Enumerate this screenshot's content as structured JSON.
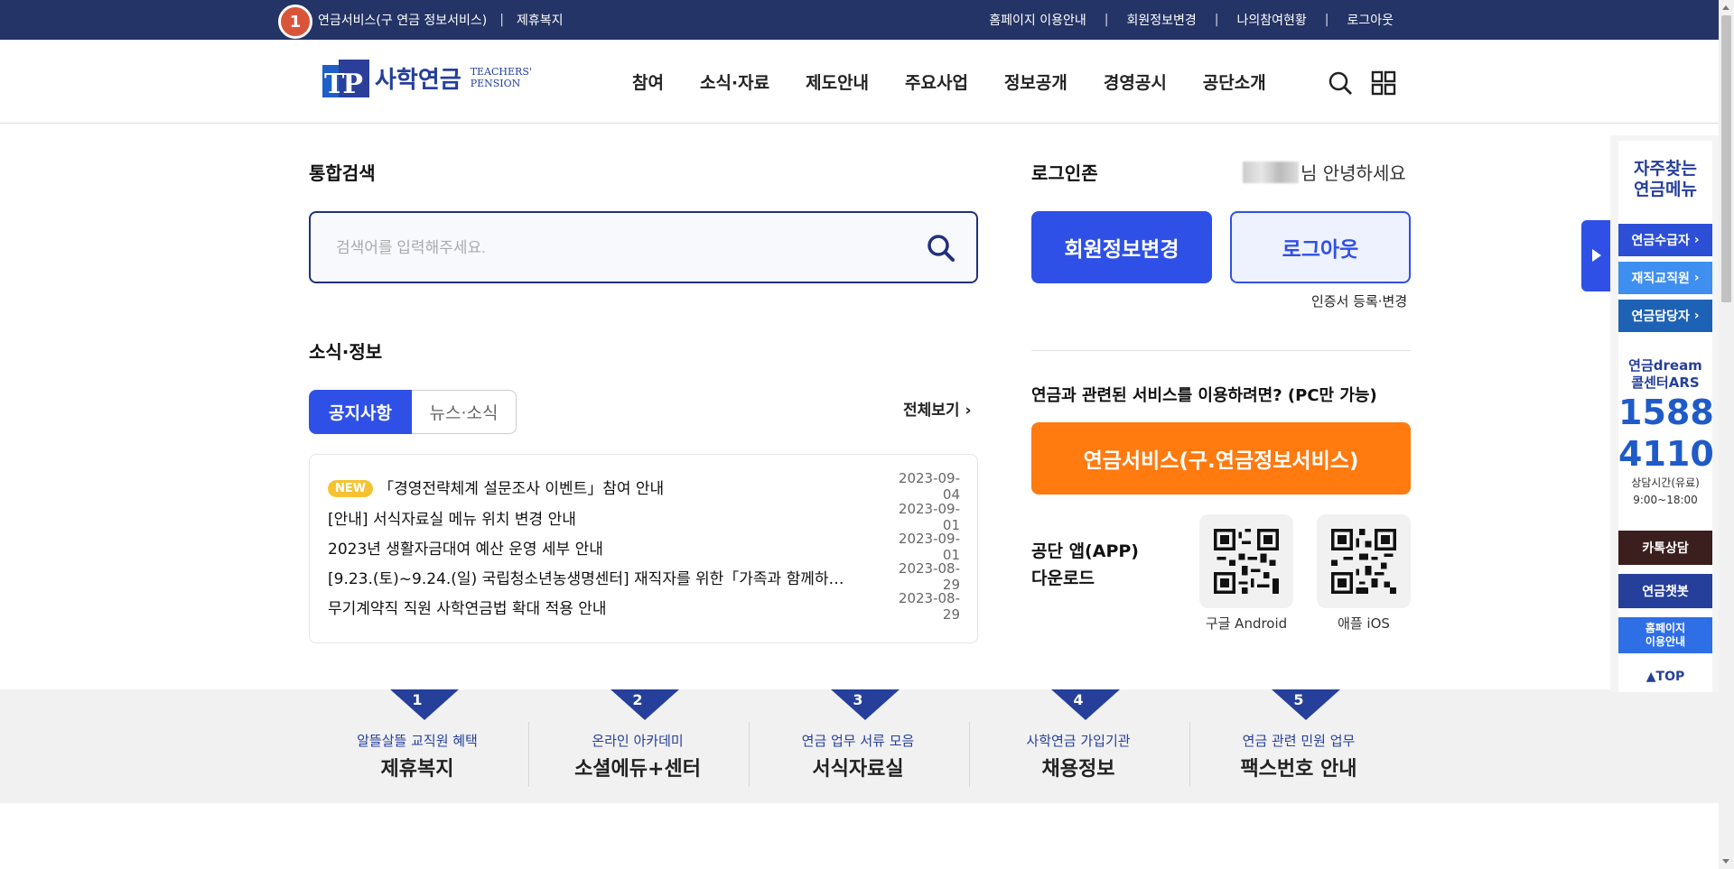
{
  "topbar": {
    "step_badge": "1",
    "left_links": [
      "연금서비스(구 연금 정보서비스)",
      "제휴복지"
    ],
    "right_links": [
      "홈페이지 이용안내",
      "회원정보변경",
      "나의참여현황",
      "로그아웃"
    ]
  },
  "logo": {
    "kr": "사학연금",
    "en_line1": "TEACHERS'",
    "en_line2": "PENSION",
    "mark": "TP"
  },
  "gnb": [
    "참여",
    "소식·자료",
    "제도안내",
    "주요사업",
    "정보공개",
    "경영공시",
    "공단소개"
  ],
  "search": {
    "title": "통합검색",
    "placeholder": "검색어를 입력해주세요."
  },
  "news": {
    "title": "소식·정보",
    "tabs": [
      "공지사항",
      "뉴스·소식"
    ],
    "more": "전체보기",
    "new_badge": "NEW",
    "items": [
      {
        "title": "「경영전략체계 설문조사 이벤트」참여 안내",
        "date": "2023-09-04"
      },
      {
        "title": "[안내] 서식자료실 메뉴 위치 변경 안내",
        "date": "2023-09-01"
      },
      {
        "title": "2023년 생활자금대여 예산 운영 세부 안내",
        "date": "2023-09-01"
      },
      {
        "title": "[9.23.(토)~9.24.(일) 국립청소년농생명센터] 재직자를 위한「가족과 함께하…",
        "date": "2023-08-29"
      },
      {
        "title": "무기계약직 직원 사학연금법 확대 적용 안내",
        "date": "2023-08-29"
      }
    ]
  },
  "login": {
    "title": "로그인존",
    "greeting": "님 안녕하세요",
    "member_btn": "회원정보변경",
    "logout_btn": "로그아웃",
    "cert_link": "인증서 등록·변경",
    "service_question": "연금과 관련된 서비스를 이용하려면? (PC만 가능)",
    "service_btn": "연금서비스(구.연금정보서비스)",
    "app_title": "공단 앱(APP) 다운로드",
    "android": "구글 Android",
    "ios": "애플 iOS"
  },
  "quick": [
    {
      "num": "1",
      "sub": "알뜰살뜰 교직원 혜택",
      "main": "제휴복지"
    },
    {
      "num": "2",
      "sub": "온라인 아카데미",
      "main": "소셜에듀+센터"
    },
    {
      "num": "3",
      "sub": "연금 업무 서류 모음",
      "main": "서식자료실"
    },
    {
      "num": "4",
      "sub": "사학연금 가입기관",
      "main": "채용정보"
    },
    {
      "num": "5",
      "sub": "연금 관련 민원 업무",
      "main": "팩스번호 안내"
    }
  ],
  "side": {
    "title_line1": "자주찾는",
    "title_line2": "연금메뉴",
    "menu": [
      "연금수급자",
      "재직교직원",
      "연금담당자"
    ],
    "ars_line1": "연금dream",
    "ars_line2": "콜센터ARS",
    "ars_num1": "1588",
    "ars_num2": "4110",
    "ars_hours1": "상담시간(유료)",
    "ars_hours2": "9:00~18:00",
    "kakao": "카톡상담",
    "chatbot": "연금챗봇",
    "guide_line1": "홈페이지",
    "guide_line2": "이용안내",
    "top": "▲TOP"
  },
  "colors": {
    "navy": "#253466",
    "blue": "#2f50e6",
    "orange": "#ff7a0f",
    "kakao": "#3b1e1e"
  }
}
